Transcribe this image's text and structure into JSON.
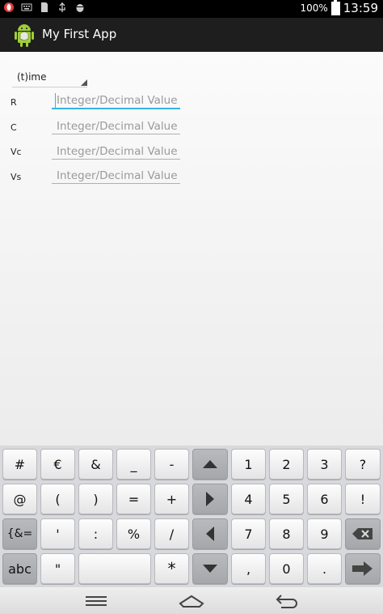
{
  "status_bar": {
    "battery": "100%",
    "time": "13:59",
    "icons": [
      "opera-icon",
      "keyboard-icon",
      "sd-card-icon",
      "usb-icon",
      "android-debug-icon"
    ]
  },
  "action_bar": {
    "title": "My First App",
    "icon": "android-app-icon"
  },
  "form": {
    "spinner_value": "(t)ime",
    "fields": [
      {
        "label": "R",
        "placeholder": "Integer/Decimal Value"
      },
      {
        "label": "C",
        "placeholder": "Integer/Decimal Value"
      },
      {
        "label": "Vc",
        "placeholder": "Integer/Decimal Value"
      },
      {
        "label": "Vs",
        "placeholder": "Integer/Decimal Value"
      }
    ]
  },
  "keyboard": {
    "row1": [
      "#",
      "€",
      "&",
      "_",
      "-",
      "",
      "1",
      "2",
      "3",
      "?"
    ],
    "row2": [
      "@",
      "(",
      ")",
      "=",
      "+",
      "",
      "4",
      "5",
      "6",
      "!"
    ],
    "row3": [
      "{&=",
      "'",
      ":",
      "%",
      "/",
      "",
      "7",
      "8",
      "9",
      ""
    ],
    "row4": [
      "abc",
      "\"",
      "",
      "*",
      "",
      ",",
      "0",
      ".",
      ""
    ]
  },
  "nav_bar": {
    "icons": [
      "menu-icon",
      "home-icon",
      "back-icon"
    ]
  },
  "colors": {
    "accent": "#33b5e5",
    "status_bar": "#000000",
    "action_bar": "#1e1e1e"
  }
}
